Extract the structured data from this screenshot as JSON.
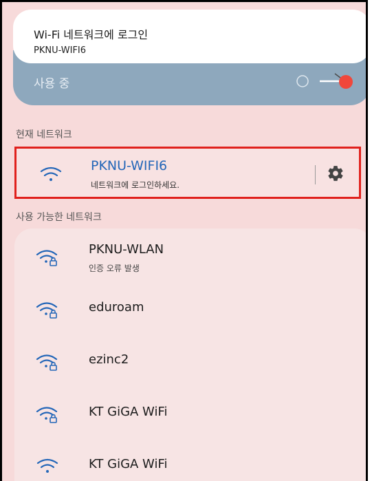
{
  "notification": {
    "title": "Wi-Fi 네트워크에 로그인",
    "subtitle": "PKNU-WIFI6"
  },
  "wifi_toggle": {
    "label": "사용 중",
    "state": "on"
  },
  "current_section": {
    "label": "현재 네트워크",
    "network": {
      "ssid": "PKNU-WIFI6",
      "status": "네트워크에 로그인하세요.",
      "icon": "wifi-icon",
      "settings_icon": "gear-icon"
    }
  },
  "available_section": {
    "label": "사용 가능한 네트워크",
    "networks": [
      {
        "ssid": "PKNU-WLAN",
        "status": "인증 오류 발생",
        "icon": "wifi-lock-icon"
      },
      {
        "ssid": "eduroam",
        "icon": "wifi-lock-icon"
      },
      {
        "ssid": "ezinc2",
        "icon": "wifi-lock-icon"
      },
      {
        "ssid": "KT GiGA WiFi",
        "icon": "wifi-lock-icon"
      },
      {
        "ssid": "KT GiGA WiFi",
        "icon": "wifi-icon"
      }
    ]
  },
  "colors": {
    "accent_blue": "#2366b8",
    "highlight_red": "#e0201c",
    "toggle_red": "#f0473b",
    "background_pink": "#f7dada"
  }
}
